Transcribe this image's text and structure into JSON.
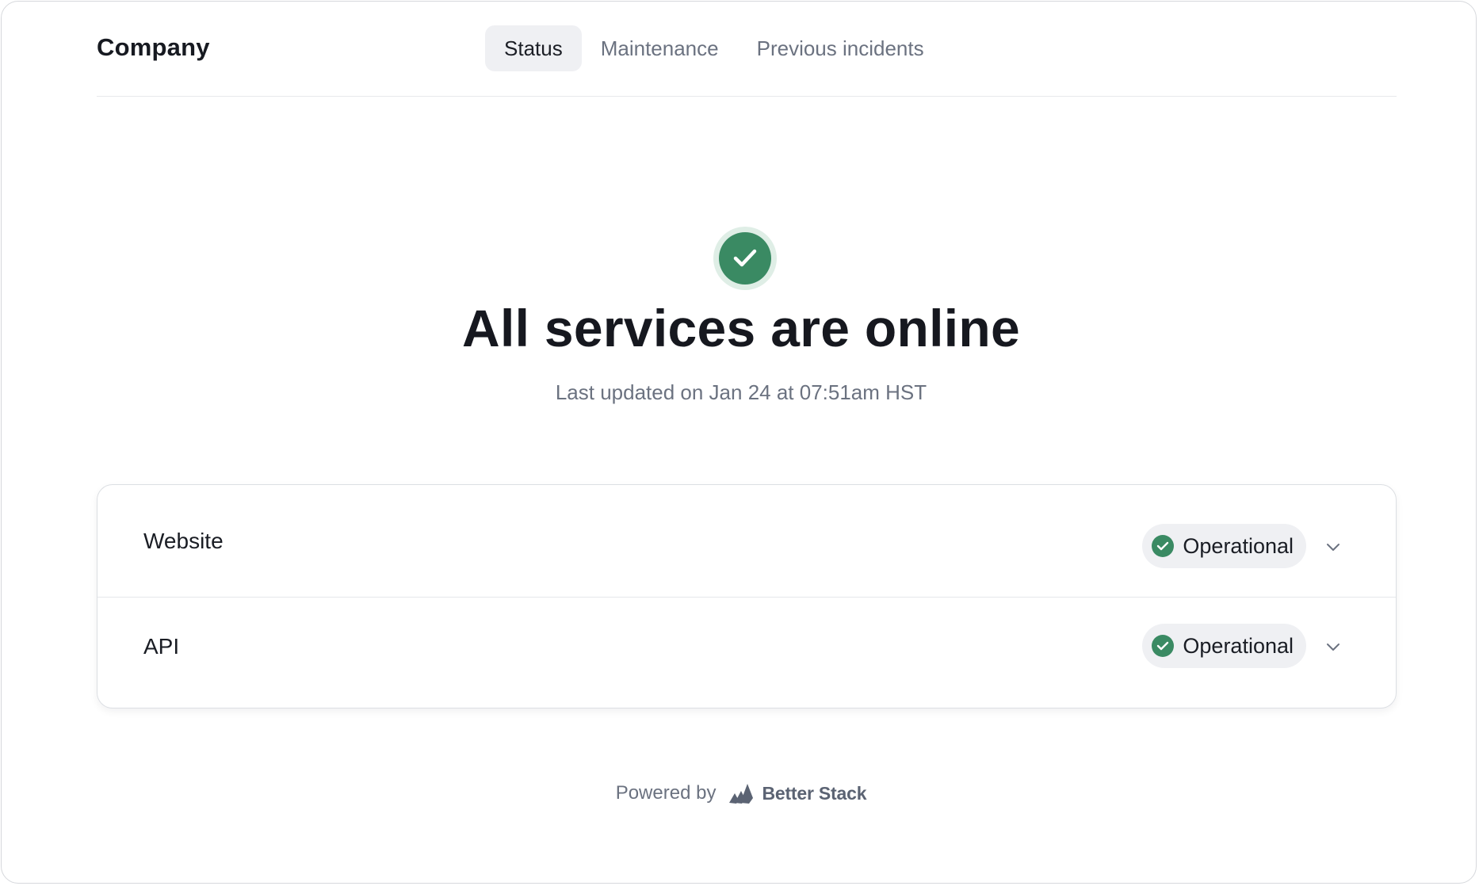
{
  "header": {
    "brand": "Company",
    "tabs": [
      {
        "label": "Status",
        "active": true
      },
      {
        "label": "Maintenance",
        "active": false
      },
      {
        "label": "Previous incidents",
        "active": false
      }
    ]
  },
  "hero": {
    "icon": "check-circle-icon",
    "title": "All services are online",
    "subtitle": "Last updated on Jan 24 at 07:51am HST"
  },
  "services": [
    {
      "name": "Website",
      "status": "Operational"
    },
    {
      "name": "API",
      "status": "Operational"
    }
  ],
  "footer": {
    "powered_by": "Powered by",
    "brand": "Better Stack"
  },
  "colors": {
    "success": "#3a8a63",
    "active_tab_bg": "#eff0f3",
    "muted_text": "#6b7280"
  }
}
